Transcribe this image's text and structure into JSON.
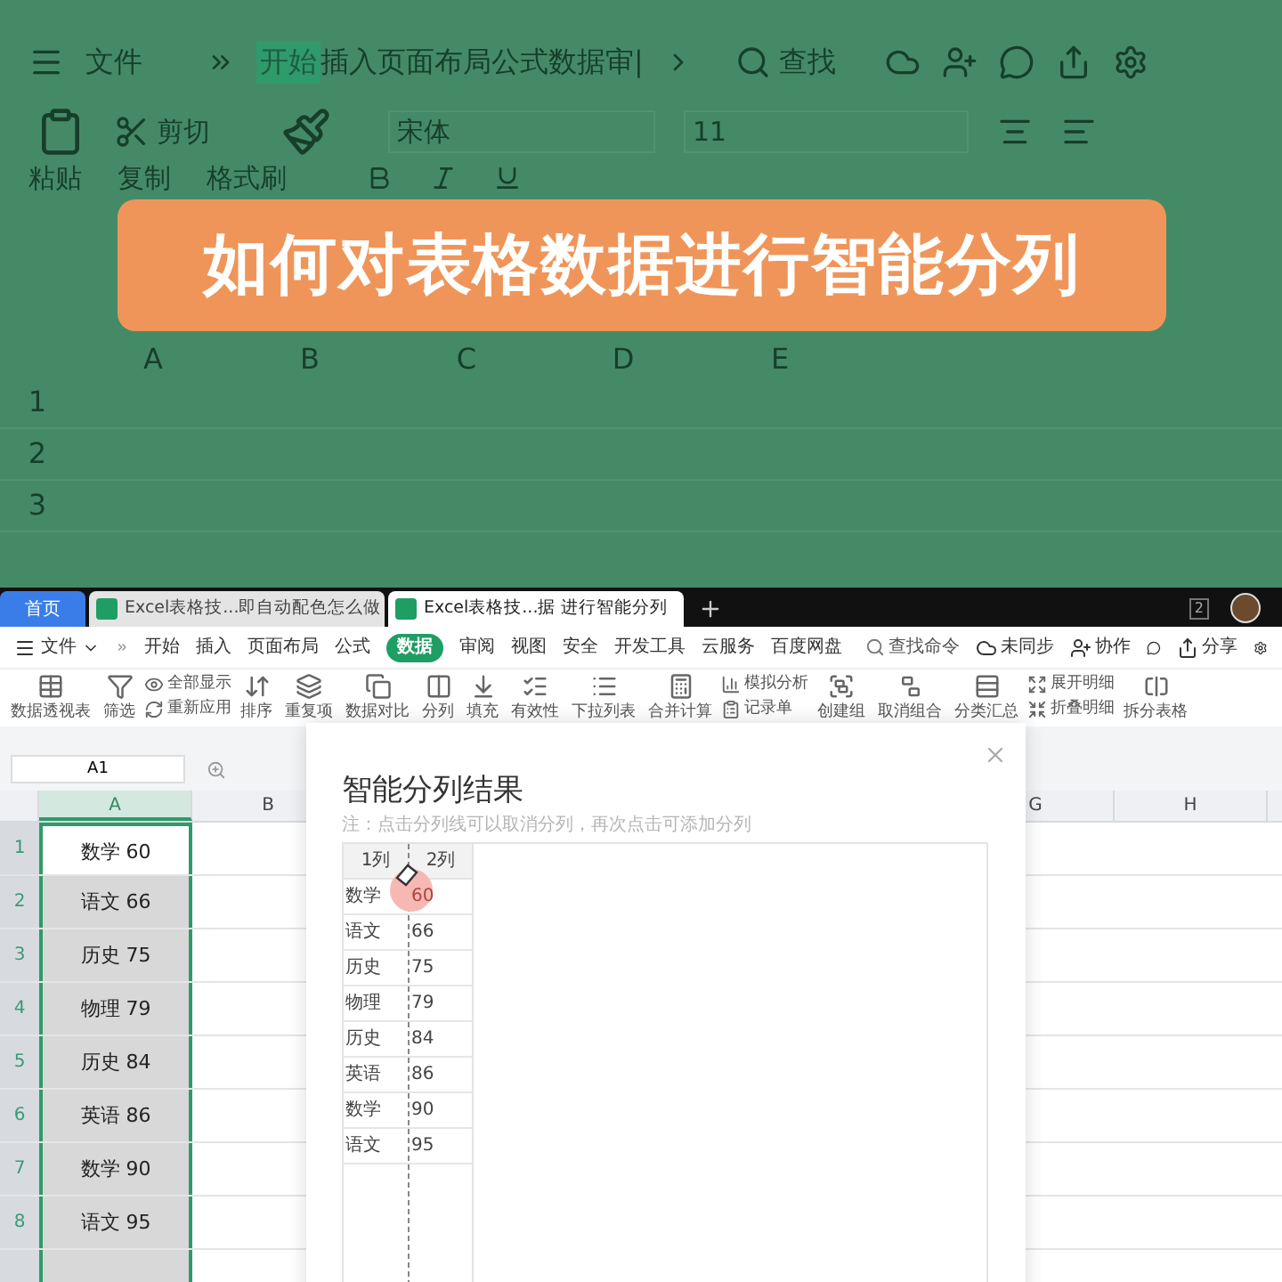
{
  "video_title": "如何对表格数据进行智能分列",
  "background_view": {
    "menu": "文件",
    "active_tab": "开始",
    "tabs_text": "插入页面布局公式数据审|",
    "search": "查找",
    "cut": "剪切",
    "font": "宋体",
    "font_size": "11",
    "paste": "粘贴",
    "copy": "复制",
    "format_painter": "格式刷",
    "columns": [
      "A",
      "B",
      "C",
      "D",
      "E"
    ],
    "rows": [
      "1",
      "2",
      "3"
    ]
  },
  "window_tabs": [
    {
      "label": "首页",
      "kind": "home",
      "selected": false
    },
    {
      "label": "Excel表格技...即自动配色怎么做",
      "kind": "doc",
      "selected": false
    },
    {
      "label": "Excel表格技...据 进行智能分列",
      "kind": "doc",
      "selected": true
    }
  ],
  "window_count": "2",
  "menu": {
    "file": "文件",
    "tabs": [
      {
        "label": "开始",
        "selected": false
      },
      {
        "label": "插入",
        "selected": false
      },
      {
        "label": "页面布局",
        "selected": false
      },
      {
        "label": "公式",
        "selected": false
      },
      {
        "label": "数据",
        "selected": true
      },
      {
        "label": "审阅",
        "selected": false
      },
      {
        "label": "视图",
        "selected": false
      },
      {
        "label": "安全",
        "selected": false
      },
      {
        "label": "开发工具",
        "selected": false
      },
      {
        "label": "云服务",
        "selected": false
      },
      {
        "label": "百度网盘",
        "selected": false
      }
    ],
    "search": "查找命令",
    "sync": "未同步",
    "collab": "协作",
    "share": "分享"
  },
  "ribbon": [
    {
      "kind": "large",
      "label": "数据透视表"
    },
    {
      "kind": "large",
      "label": "筛选"
    },
    {
      "kind": "pair",
      "items": [
        "全部显示",
        "重新应用"
      ]
    },
    {
      "kind": "large",
      "label": "排序"
    },
    {
      "kind": "large",
      "label": "重复项"
    },
    {
      "kind": "large",
      "label": "数据对比"
    },
    {
      "kind": "large",
      "label": "分列"
    },
    {
      "kind": "large",
      "label": "填充"
    },
    {
      "kind": "large",
      "label": "有效性"
    },
    {
      "kind": "large",
      "label": "下拉列表"
    },
    {
      "kind": "large",
      "label": "合并计算"
    },
    {
      "kind": "pair",
      "items": [
        "模拟分析",
        "记录单"
      ]
    },
    {
      "kind": "large",
      "label": "创建组"
    },
    {
      "kind": "large",
      "label": "取消组合"
    },
    {
      "kind": "large",
      "label": "分类汇总"
    },
    {
      "kind": "pair",
      "items": [
        "展开明细",
        "折叠明细"
      ]
    },
    {
      "kind": "large",
      "label": "拆分表格"
    }
  ],
  "name_box": "A1",
  "sheet": {
    "columns": [
      {
        "label": "A",
        "selected": true
      },
      {
        "label": "B",
        "selected": false
      },
      {
        "label": "G",
        "selected": false
      },
      {
        "label": "H",
        "selected": false
      }
    ],
    "rows": [
      {
        "number": "1",
        "value": "数学 60",
        "active": true
      },
      {
        "number": "2",
        "value": "语文 66",
        "active": false
      },
      {
        "number": "3",
        "value": "历史 75",
        "active": false
      },
      {
        "number": "4",
        "value": "物理 79",
        "active": false
      },
      {
        "number": "5",
        "value": "历史 84",
        "active": false
      },
      {
        "number": "6",
        "value": "英语 86",
        "active": false
      },
      {
        "number": "7",
        "value": "数学 90",
        "active": false
      },
      {
        "number": "8",
        "value": "语文 95",
        "active": false
      }
    ]
  },
  "dialog": {
    "title": "智能分列结果",
    "note": "注：点击分列线可以取消分列，再次点击可添加分列",
    "columns": [
      "1列",
      "2列"
    ],
    "rows": [
      {
        "column_1": "数学",
        "column_2": "60"
      },
      {
        "column_1": "语文",
        "column_2": "66"
      },
      {
        "column_1": "历史",
        "column_2": "75"
      },
      {
        "column_1": "物理",
        "column_2": "79"
      },
      {
        "column_1": "历史",
        "column_2": "84"
      },
      {
        "column_1": "英语",
        "column_2": "86"
      },
      {
        "column_1": "数学",
        "column_2": "90"
      },
      {
        "column_1": "语文",
        "column_2": "95"
      }
    ]
  }
}
